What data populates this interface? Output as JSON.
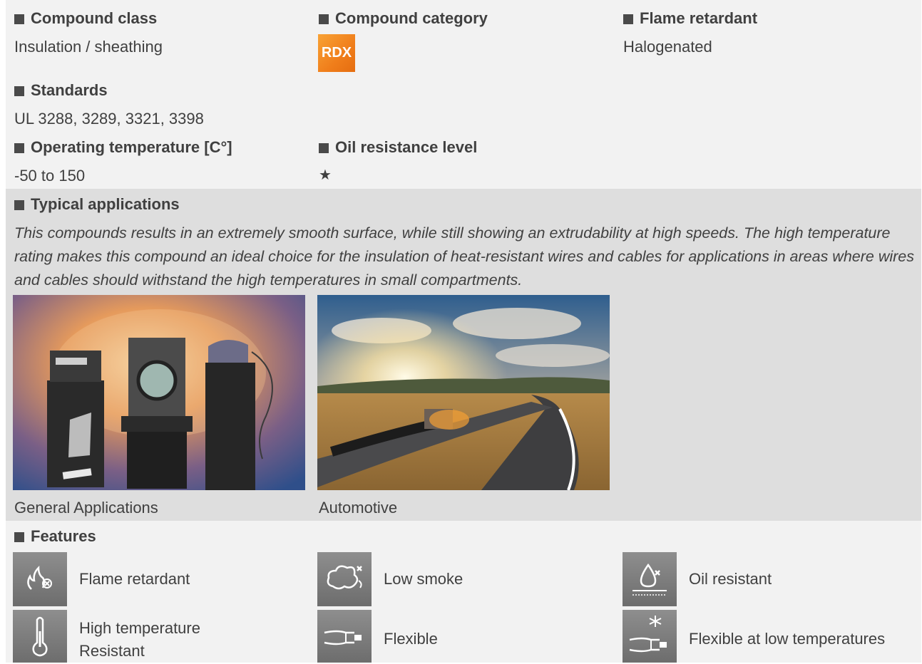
{
  "info": {
    "compound_class_heading": "Compound class",
    "compound_class_value": "Insulation / sheathing",
    "compound_category_heading": "Compound category",
    "compound_category_badge": "RDX",
    "flame_retardant_heading": "Flame retardant",
    "flame_retardant_value": "Halogenated",
    "standards_heading": "Standards",
    "standards_value": "UL 3288, 3289, 3321, 3398",
    "operating_temp_heading": "Operating temperature [C°]",
    "operating_temp_value": "-50 to 150",
    "oil_resistance_heading": "Oil resistance level",
    "oil_resistance_value": "★"
  },
  "applications": {
    "heading": "Typical applications",
    "description": "This compounds results in an extremely smooth surface, while still showing an extrudability at high speeds. The high temperature rating makes this compound an ideal choice for the insulation of heat-resistant wires and cables for applications in areas where wires and cables should withstand the high temperatures in small compartments.",
    "images": [
      {
        "caption": "General Applications"
      },
      {
        "caption": "Automotive"
      }
    ]
  },
  "features": {
    "heading": "Features",
    "items": [
      {
        "label": "Flame retardant",
        "icon": "flame-retardant-icon"
      },
      {
        "label": "Low smoke",
        "icon": "low-smoke-icon"
      },
      {
        "label": "Oil resistant",
        "icon": "oil-resistant-icon"
      },
      {
        "label": "High temperature Resistant",
        "icon": "thermometer-icon"
      },
      {
        "label": "Flexible",
        "icon": "flexible-cable-icon"
      },
      {
        "label": "Flexible at low temperatures",
        "icon": "snowflake-cable-icon"
      }
    ]
  },
  "colors": {
    "panel_light": "#f2f2f2",
    "panel_mid": "#dedede",
    "badge_orange": "#f07e1b",
    "icon_gray": "#7a7a7a"
  }
}
